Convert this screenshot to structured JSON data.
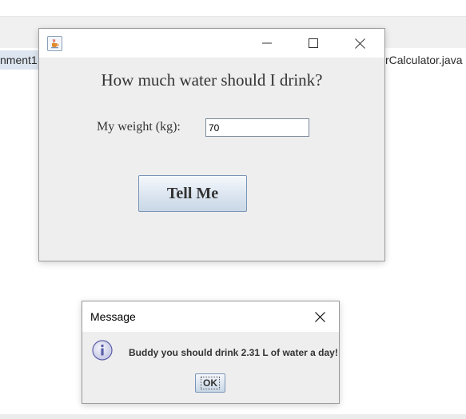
{
  "ide": {
    "tab_left_label": "nment1.",
    "tab_right_label": "rCalculator.java"
  },
  "frame": {
    "question": "How much water should I drink?",
    "weight_label": "My weight (kg):",
    "weight_value": "70",
    "tell_button": "Tell Me",
    "controls": {
      "minimize": "minimize-icon",
      "maximize": "maximize-icon",
      "close": "close-icon"
    }
  },
  "dialog": {
    "title": "Message",
    "message": "Buddy you should drink 2.31 L of water a day!",
    "ok_label": "OK",
    "icon": "info-icon"
  },
  "colors": {
    "button_border": "#7a95b5",
    "info_icon": "#5b5fa8",
    "frame_bg": "#eeeeee"
  }
}
